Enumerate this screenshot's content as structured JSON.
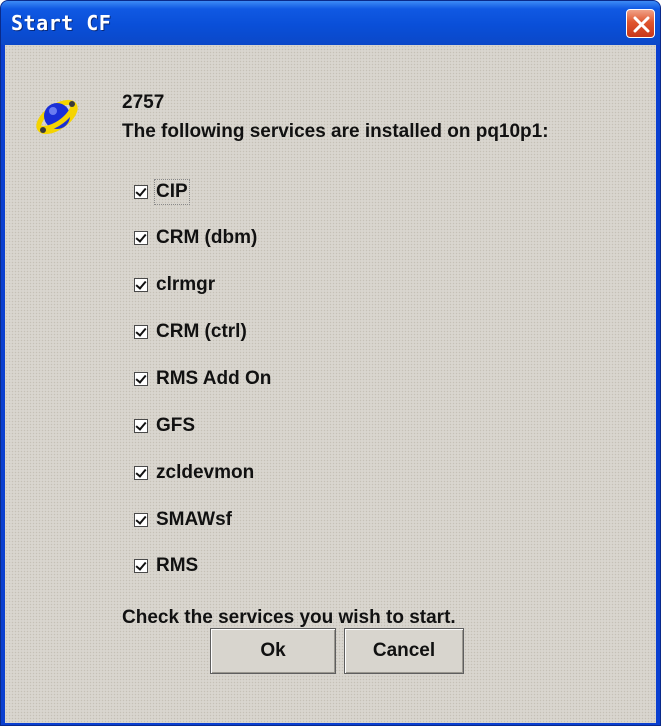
{
  "window": {
    "title": "Start CF",
    "close_icon": "close-x-icon"
  },
  "dialog": {
    "icon": "cf-globe-icon",
    "code": "2757",
    "message": "The following services are installed on pq10p1:",
    "services": [
      {
        "label": "CIP",
        "checked": true
      },
      {
        "label": "CRM (dbm)",
        "checked": true
      },
      {
        "label": "clrmgr",
        "checked": true
      },
      {
        "label": "CRM (ctrl)",
        "checked": true
      },
      {
        "label": "RMS Add On",
        "checked": true
      },
      {
        "label": "GFS",
        "checked": true
      },
      {
        "label": "zcldevmon",
        "checked": true
      },
      {
        "label": "SMAWsf",
        "checked": true
      },
      {
        "label": "RMS",
        "checked": true
      }
    ],
    "footer": "Check the services you wish to start.",
    "ok_label": "Ok",
    "cancel_label": "Cancel"
  },
  "colors": {
    "titlebar": "#0a4fd8",
    "close_button": "#e0562e",
    "client_bg": "#d9d6cf"
  }
}
